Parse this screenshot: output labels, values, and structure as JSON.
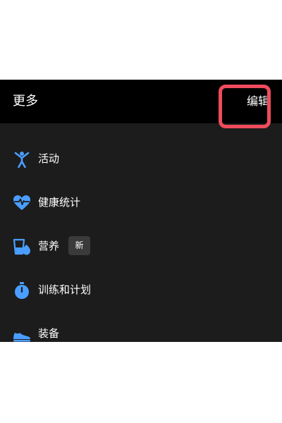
{
  "header": {
    "title": "更多",
    "edit_label": "编辑"
  },
  "menu": {
    "items": [
      {
        "label": "活动",
        "icon": "activity-person-icon"
      },
      {
        "label": "健康统计",
        "icon": "heart-pulse-icon"
      },
      {
        "label": "营养",
        "icon": "nutrition-cup-icon",
        "badge": "新"
      },
      {
        "label": "训练和计划",
        "icon": "stopwatch-icon"
      },
      {
        "label": "装备",
        "icon": "shoe-icon"
      }
    ]
  },
  "colors": {
    "accent": "#4a9eff",
    "highlight": "#ef4b5d",
    "background": "#1c1c1c",
    "header": "#000000"
  }
}
